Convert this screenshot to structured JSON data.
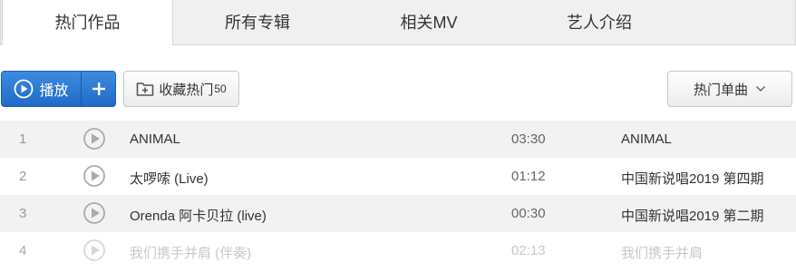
{
  "tabs": [
    {
      "label": "热门作品",
      "active": true
    },
    {
      "label": "所有专辑",
      "active": false
    },
    {
      "label": "相关MV",
      "active": false
    },
    {
      "label": "艺人介绍",
      "active": false
    }
  ],
  "toolbar": {
    "play_label": "播放",
    "add_label": "+",
    "favorite_label": "收藏热门",
    "favorite_count": "50",
    "sort_label": "热门单曲"
  },
  "songs": [
    {
      "index": "1",
      "title": "ANIMAL",
      "duration": "03:30",
      "album": "ANIMAL",
      "available": true
    },
    {
      "index": "2",
      "title": "太啰嗦 (Live)",
      "duration": "01:12",
      "album": "中国新说唱2019 第四期",
      "available": true
    },
    {
      "index": "3",
      "title": "Orenda 阿卡贝拉 (live)",
      "duration": "00:30",
      "album": "中国新说唱2019 第二期",
      "available": true
    },
    {
      "index": "4",
      "title": "我们携手并肩 (伴奏)",
      "duration": "02:13",
      "album": "我们携手并肩",
      "available": false
    }
  ],
  "colors": {
    "accent": "#2a78d4",
    "row_stripe": "#f2f2f2",
    "disabled_text": "#c8c8c8"
  }
}
